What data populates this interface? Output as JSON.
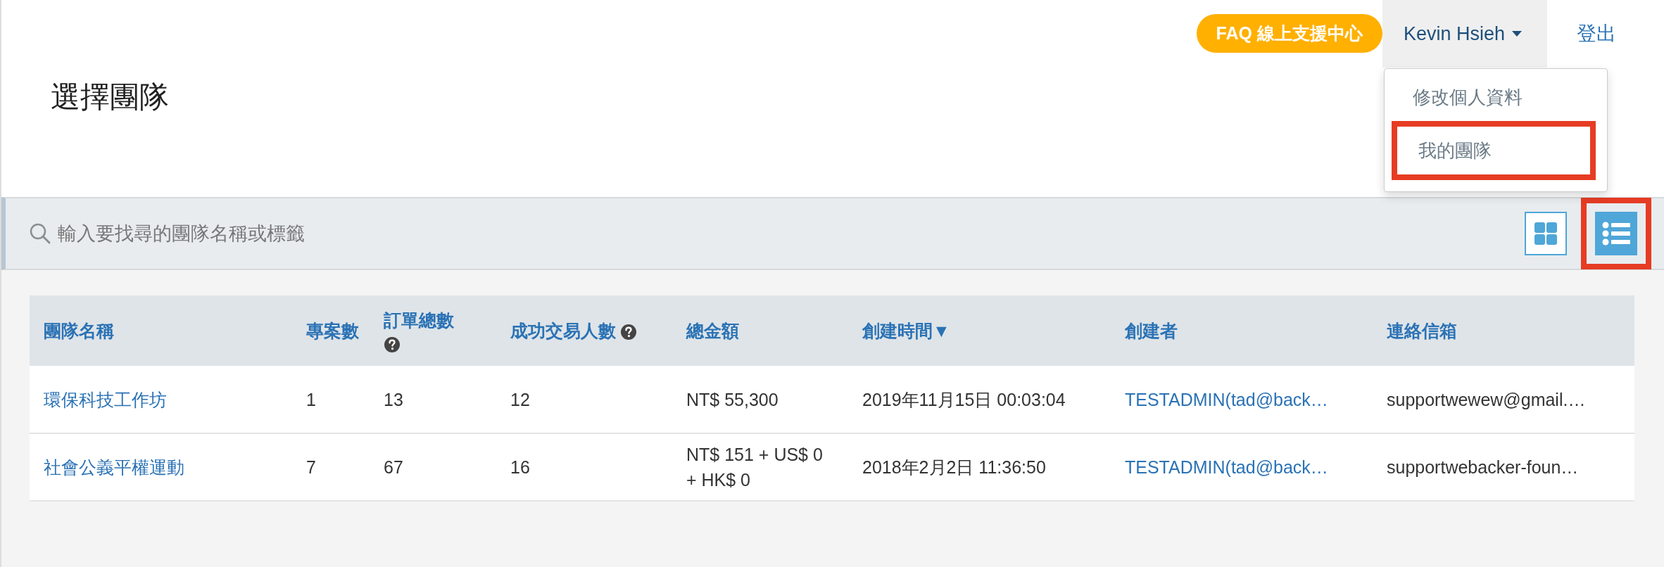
{
  "header": {
    "faq_button": "FAQ 線上支援中心",
    "user_menu": {
      "label": "Kevin Hsieh",
      "expanded": true,
      "items": [
        {
          "label": "修改個人資料",
          "highlighted": false
        },
        {
          "label": "我的團隊",
          "highlighted": true
        }
      ]
    },
    "logout": "登出"
  },
  "page_title": "選擇團隊",
  "search": {
    "placeholder": "輸入要找尋的團隊名稱或標籤"
  },
  "view_toggle": [
    {
      "kind": "grid",
      "selected": false,
      "highlighted": false
    },
    {
      "kind": "list",
      "selected": true,
      "highlighted": true
    }
  ],
  "table": {
    "columns": [
      {
        "label": "團隊名稱"
      },
      {
        "label": "專案數"
      },
      {
        "label": "訂單總數",
        "help": true
      },
      {
        "label": "成功交易人數",
        "help": true
      },
      {
        "label": "總金額"
      },
      {
        "label": "創建時間",
        "sort_mark": "▼"
      },
      {
        "label": "創建者"
      },
      {
        "label": "連絡信箱"
      }
    ],
    "rows": [
      {
        "cells": [
          {
            "kind": "link",
            "text": "環保科技工作坊"
          },
          {
            "kind": "text",
            "text": "1"
          },
          {
            "kind": "text",
            "text": "13"
          },
          {
            "kind": "text",
            "text": "12"
          },
          {
            "kind": "text",
            "text": "NT$ 55,300"
          },
          {
            "kind": "text",
            "text": "2019年11月15日 00:03:04"
          },
          {
            "kind": "link",
            "text": "TESTADMIN(tad@back…"
          },
          {
            "kind": "text",
            "text": "supportwewew@gmail.…"
          }
        ]
      },
      {
        "cells": [
          {
            "kind": "link",
            "text": "社會公義平權運動"
          },
          {
            "kind": "text",
            "text": "7"
          },
          {
            "kind": "text",
            "text": "67"
          },
          {
            "kind": "text",
            "text": "16"
          },
          {
            "kind": "text",
            "text": "NT$ 151 + US$ 0 + HK$ 0"
          },
          {
            "kind": "text",
            "text": "2018年2月2日 11:36:50"
          },
          {
            "kind": "link",
            "text": "TESTADMIN(tad@back…"
          },
          {
            "kind": "text",
            "text": "supportwebacker-foun…"
          }
        ]
      }
    ]
  }
}
